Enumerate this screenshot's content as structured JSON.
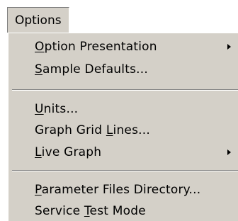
{
  "menubar": {
    "title": "Options"
  },
  "menu": {
    "groups": [
      {
        "items": [
          {
            "label": "Option Presentation",
            "accel_index": 0,
            "submenu": true,
            "arrow_icon": "submenu-arrow-icon"
          },
          {
            "label": "Sample Defaults...",
            "accel_index": 0,
            "submenu": false
          }
        ]
      },
      {
        "items": [
          {
            "label": "Units...",
            "accel_index": 0,
            "submenu": false
          },
          {
            "label": "Graph Grid Lines...",
            "accel_index": 11,
            "submenu": false
          },
          {
            "label": "Live Graph",
            "accel_index": 0,
            "submenu": true,
            "arrow_icon": "submenu-arrow-icon"
          }
        ]
      },
      {
        "items": [
          {
            "label": "Parameter Files Directory...",
            "accel_index": 0,
            "submenu": false
          },
          {
            "label": "Service Test Mode",
            "accel_index": 8,
            "submenu": false
          }
        ]
      }
    ]
  },
  "colors": {
    "menu_bg": "#d4d0c8",
    "text": "#000000",
    "shadow": "#808080",
    "highlight": "#ffffff"
  }
}
